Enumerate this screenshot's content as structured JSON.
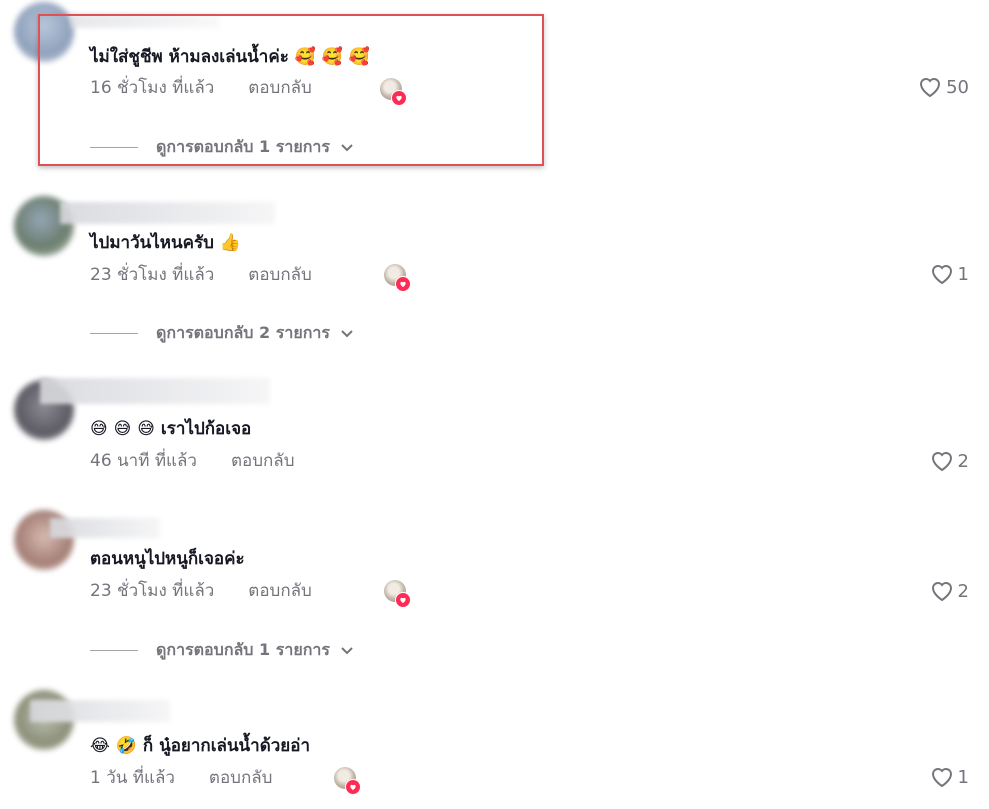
{
  "colors": {
    "accent_heart": "#fe2c55",
    "muted_text": "#74757c",
    "highlight_border": "#e05155"
  },
  "comments": [
    {
      "text": "ไม่ใส่ชูชีพ ห้ามลงเล่นน้ำค่ะ 🥰 🥰 🥰",
      "time": "16 ชั่วโมง ที่แล้ว",
      "reply_label": "ตอบกลับ",
      "likes": "50",
      "creator_liked": true,
      "view_replies": "ดูการตอบกลับ 1 รายการ"
    },
    {
      "text": "ไปมาวันไหนครับ 👍",
      "time": "23 ชั่วโมง ที่แล้ว",
      "reply_label": "ตอบกลับ",
      "likes": "1",
      "creator_liked": true,
      "view_replies": "ดูการตอบกลับ 2 รายการ"
    },
    {
      "text": "😅 😅 😅 เราไปก้อเจอ",
      "time": "46 นาที ที่แล้ว",
      "reply_label": "ตอบกลับ",
      "likes": "2",
      "creator_liked": false
    },
    {
      "text": "ตอนหนูไปหนูก็เจอค่ะ",
      "time": "23 ชั่วโมง ที่แล้ว",
      "reply_label": "ตอบกลับ",
      "likes": "2",
      "creator_liked": true,
      "view_replies": "ดูการตอบกลับ 1 รายการ"
    },
    {
      "text": "😂 🤣 ก็ นู๋อยากเล่นน้ำด้วยอ่า",
      "time": "1 วัน ที่แล้ว",
      "reply_label": "ตอบกลับ",
      "likes": "1",
      "creator_liked": true
    }
  ]
}
